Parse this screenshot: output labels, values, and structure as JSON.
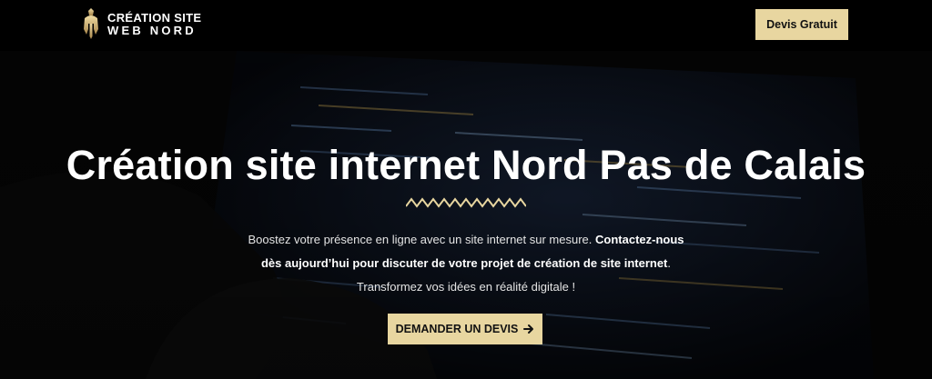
{
  "header": {
    "logo_line1": "CRÉATION SITE",
    "logo_line2": "WEB NORD",
    "logo_icon": "spartan-helmet-icon",
    "cta_label": "Devis Gratuit"
  },
  "hero": {
    "title": "Création site internet Nord Pas de Calais",
    "divider_icon": "zigzag-divider",
    "text_part1": "Boostez votre présence en ligne avec un site internet sur mesure. ",
    "text_bold_line1": "Contactez-nous",
    "text_bold_line2": "dès aujourd’hui pour discuter de votre projet de création de site internet",
    "text_part2": ".",
    "text_line3": "Transformez vos idées en réalité digitale !",
    "cta_label": "DEMANDER UN DEVIS",
    "cta_icon": "arrow-right-icon"
  },
  "colors": {
    "accent": "#e8d6a0",
    "background": "#000000",
    "text": "#ffffff"
  }
}
